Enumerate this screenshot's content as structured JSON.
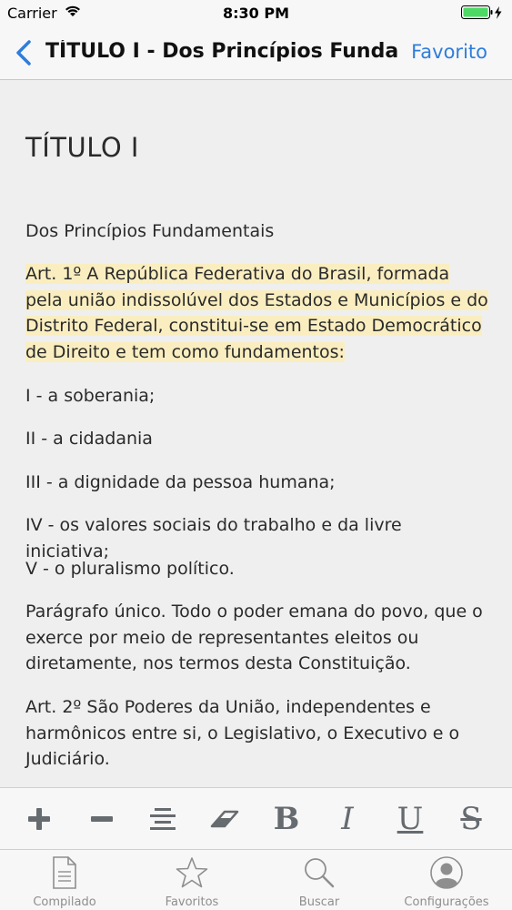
{
  "status_bar": {
    "carrier": "Carrier",
    "time": "8:30 PM"
  },
  "nav": {
    "title": "TÍTULO I - Dos Princípios Fundam...",
    "favorite_label": "Favorito"
  },
  "document": {
    "title": "TÍTULO I",
    "paragraphs": [
      "Dos Princípios Fundamentais",
      "Art. 1º A República Federativa do Brasil, formada pela união indissolúvel dos Estados e Municípios e do Distrito Federal, constitui-se em Estado Democrático de Direito e tem como fundamentos:",
      "I - a soberania;",
      "II - a cidadania",
      "III - a dignidade da pessoa humana;",
      "IV - os valores sociais do trabalho e da livre iniciativa;",
      "V - o pluralismo político.",
      "Parágrafo único. Todo o poder emana do povo, que o exerce por meio de representantes eleitos ou diretamente, nos termos desta Constituição.",
      "Art. 2º São Poderes da União, independentes e harmônicos entre si, o Legislativo, o Executivo e o Judiciário."
    ],
    "highlight_color": "#faeec0"
  },
  "toolbar": {
    "bold_glyph": "B",
    "italic_glyph": "I",
    "underline_glyph": "U",
    "strike_glyph": "S"
  },
  "tabs": [
    {
      "label": "Compilado",
      "icon": "document-icon"
    },
    {
      "label": "Favoritos",
      "icon": "star-icon"
    },
    {
      "label": "Buscar",
      "icon": "search-icon"
    },
    {
      "label": "Configurações",
      "icon": "profile-icon"
    }
  ],
  "colors": {
    "accent": "#2f7ddb",
    "battery": "#4cd964",
    "icon_gray": "#666b70"
  }
}
